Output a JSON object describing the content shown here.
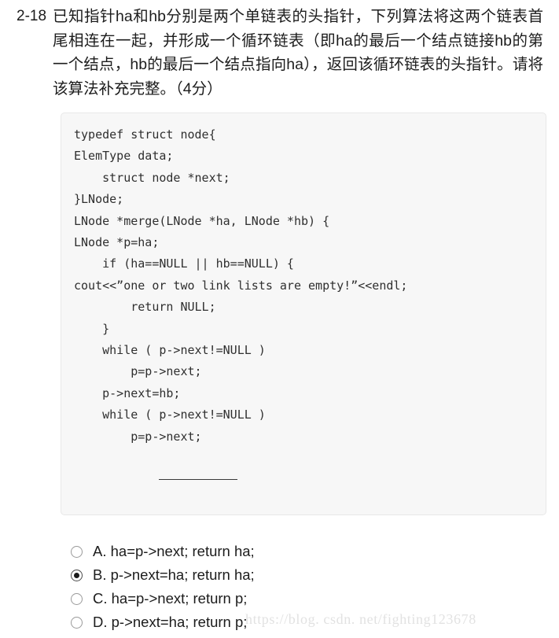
{
  "question": {
    "number": "2-18",
    "text": "已知指针ha和hb分别是两个单链表的头指针，下列算法将这两个链表首尾相连在一起，并形成一个循环链表（即ha的最后一个结点链接hb的第一个结点，hb的最后一个结点指向ha），返回该循环链表的头指针。请将该算法补充完整。（4分）"
  },
  "code": {
    "part1": "typedef struct node{\nElemType data;\n    struct node *next;\n}LNode;\nLNode *merge(LNode *ha, LNode *hb) {\nLNode *p=ha;\n    if (ha==NULL || hb==NULL) {\ncout<<”one or two link lists are empty!”<<endl;\n        return NULL;\n    }\n    while ( p->next!=NULL )\n        p=p->next;\n    p->next=hb;\n    while ( p->next!=NULL )\n        p=p->next;",
    "blank_indent": "        ",
    "part2": "}"
  },
  "options": [
    {
      "id": "A",
      "label": "A. ha=p->next; return ha;",
      "selected": false
    },
    {
      "id": "B",
      "label": "B. p->next=ha; return ha;",
      "selected": true
    },
    {
      "id": "C",
      "label": "C. ha=p->next; return p;",
      "selected": false
    },
    {
      "id": "D",
      "label": "D. p->next=ha; return p;",
      "selected": false
    }
  ],
  "watermark": {
    "text": "https://blog. csdn. net/fighting123678"
  },
  "colors": {
    "page_background": "#ffffff",
    "code_background": "#f7f7f7",
    "code_border": "#e8e8e8",
    "text": "#1c1c1c",
    "code_text": "#2f2f2f",
    "radio_border": "#9a9a9a",
    "radio_dot": "#1a1a1a",
    "watermark": "#e2e2e2"
  }
}
